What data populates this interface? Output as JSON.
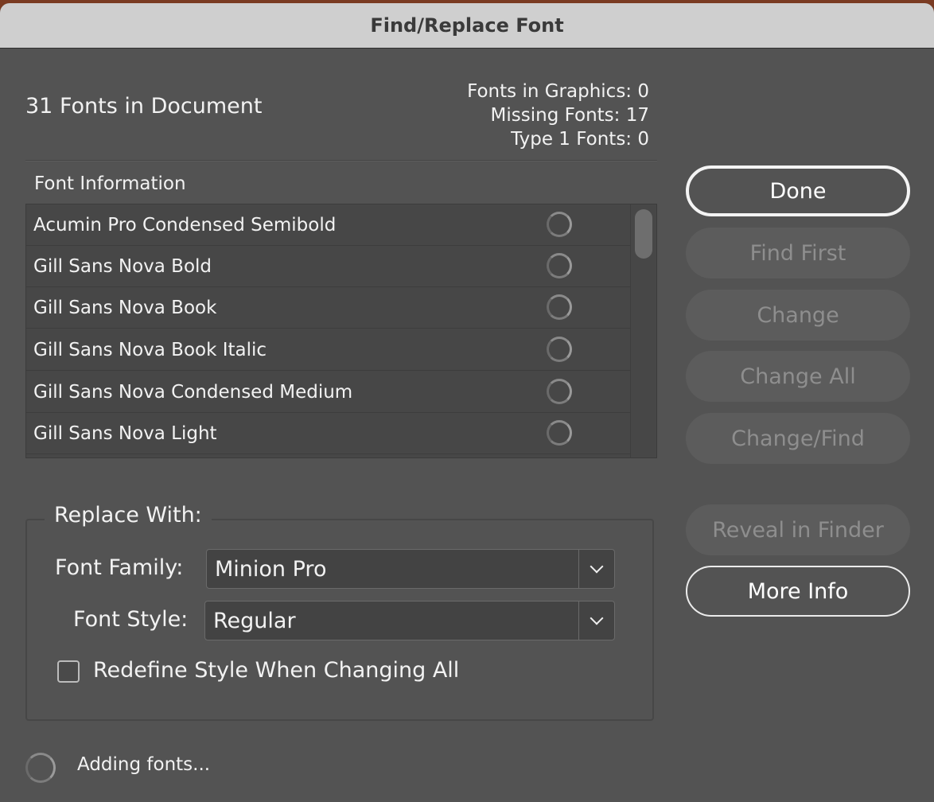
{
  "window": {
    "title": "Find/Replace Font"
  },
  "summary": {
    "doc_fonts": "31 Fonts in Document",
    "stats": [
      "Fonts in Graphics: 0",
      "Missing Fonts: 17",
      "Type 1 Fonts: 0"
    ]
  },
  "font_info": {
    "label": "Font Information",
    "fonts": [
      "Acumin Pro Condensed Semibold",
      "Gill Sans Nova Bold",
      "Gill Sans Nova Book",
      "Gill Sans Nova Book Italic",
      "Gill Sans Nova Condensed Medium",
      "Gill Sans Nova Light"
    ],
    "row_icon": "loading-spinner-icon"
  },
  "replace": {
    "legend": "Replace With:",
    "family_label": "Font Family:",
    "family_value": "Minion Pro",
    "style_label": "Font Style:",
    "style_value": "Regular",
    "redefine_label": "Redefine Style When Changing All",
    "redefine_checked": false
  },
  "buttons": {
    "done": "Done",
    "find_first": "Find First",
    "change": "Change",
    "change_all": "Change All",
    "change_find": "Change/Find",
    "reveal": "Reveal in Finder",
    "more_info": "More Info"
  },
  "status": {
    "text": "Adding fonts..."
  }
}
